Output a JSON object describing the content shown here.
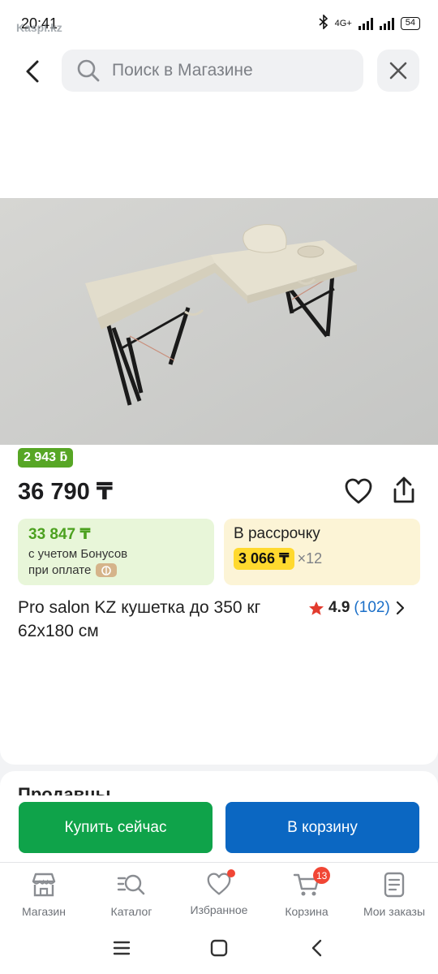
{
  "status_bar": {
    "time": "20:41",
    "watermark": "Kaspi.kz",
    "network": "4G+",
    "battery": "54"
  },
  "header": {
    "search_placeholder": "Поиск в Магазине"
  },
  "product": {
    "bonus_badge": "2 943 ƃ",
    "price": "36 790 ₸",
    "bonus_price": {
      "amount": "33 847 ₸",
      "line1": "с учетом Бонусов",
      "line2": "при оплате"
    },
    "installment": {
      "title": "В рассрочку",
      "amount": "3 066 ₸",
      "multiplier": "×12"
    },
    "title": "Pro salon KZ кушетка до 350 кг 62x180 см",
    "rating": {
      "score": "4.9",
      "count": "(102)"
    },
    "gallery": {
      "total_images": 5,
      "active_index": 0
    }
  },
  "section_peek": {
    "title": "Продавцы"
  },
  "actions": {
    "buy_now": "Купить сейчас",
    "add_to_cart": "В корзину"
  },
  "tabbar": {
    "items": [
      {
        "label": "Магазин",
        "icon": "store-icon"
      },
      {
        "label": "Каталог",
        "icon": "catalog-search-icon"
      },
      {
        "label": "Избранное",
        "icon": "heart-icon"
      },
      {
        "label": "Корзина",
        "icon": "cart-icon",
        "badge": "13"
      },
      {
        "label": "Мои заказы",
        "icon": "orders-icon"
      }
    ]
  },
  "colors": {
    "bonus_green": "#57a625",
    "buy_green": "#0fa34a",
    "cart_blue": "#0b67c2",
    "installment_yellow": "#ffd92e",
    "badge_red": "#f14635",
    "link_blue": "#1b6fc8"
  }
}
